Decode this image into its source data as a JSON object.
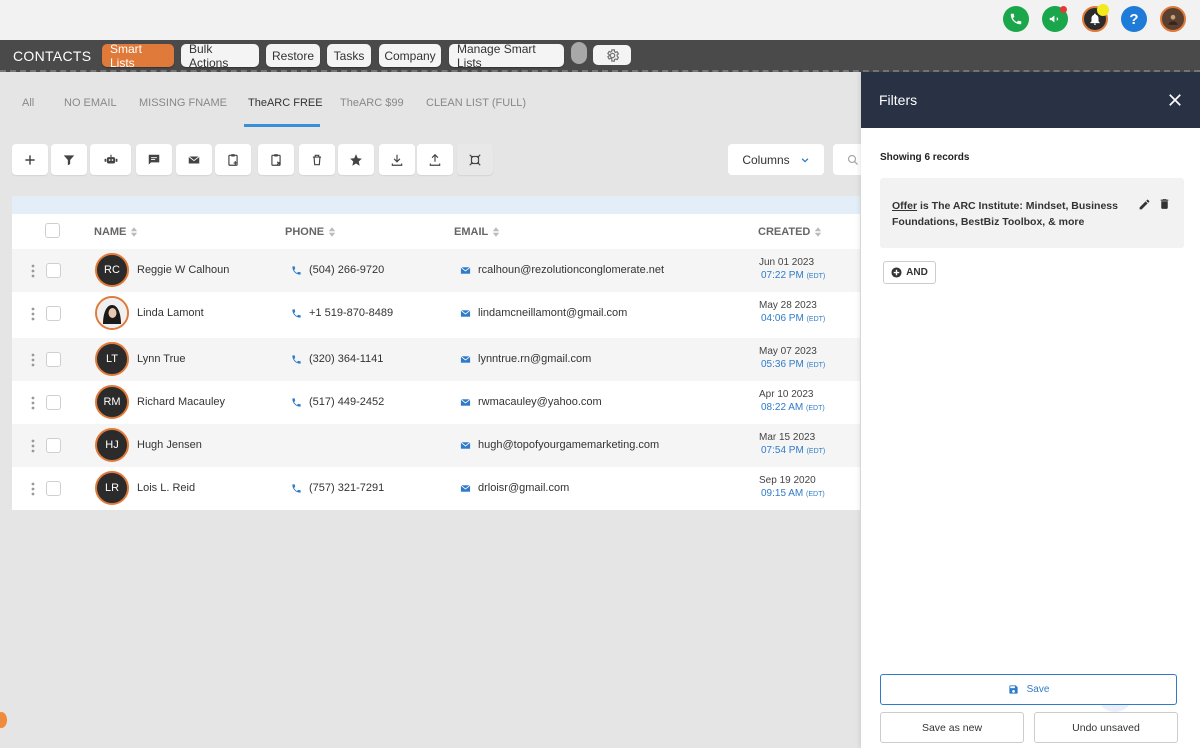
{
  "colors": {
    "accent": "#e07a3a",
    "link": "#2f7bc8",
    "panel_header": "#283244",
    "phone_green": "#1aa64a",
    "help_blue": "#1e7bd8"
  },
  "topbar": {
    "icons": [
      "phone-icon",
      "megaphone-icon",
      "bell-icon",
      "help-icon",
      "user-avatar"
    ],
    "help_label": "?"
  },
  "nav": {
    "title": "CONTACTS",
    "buttons": [
      "Smart Lists",
      "Bulk Actions",
      "Restore",
      "Tasks",
      "Company",
      "Manage Smart Lists"
    ]
  },
  "tabs": [
    "All",
    "NO EMAIL",
    "MISSING FNAME",
    "TheARC FREE",
    "TheARC $99",
    "CLEAN LIST (FULL)"
  ],
  "toolbar": {
    "icons": [
      "add-icon",
      "filter-icon",
      "robot-icon",
      "message-icon",
      "email-icon",
      "clipboard-add-icon",
      "clipboard-remove-icon",
      "trash-icon",
      "star-icon",
      "download-icon",
      "upload-icon",
      "merge-icon"
    ],
    "columns_label": "Columns"
  },
  "table": {
    "headers": {
      "name": "NAME",
      "phone": "PHONE",
      "email": "EMAIL",
      "created": "CREATED"
    },
    "rows": [
      {
        "initials": "RC",
        "name": "Reggie W Calhoun",
        "phone": "(504) 266-9720",
        "email": "rcalhoun@rezolutionconglomerate.net",
        "date": "Jun 01 2023",
        "time": "07:22 PM",
        "tz": "(EDT)"
      },
      {
        "initials": "",
        "name": "Linda Lamont",
        "phone": "+1 519-870-8489",
        "email": "lindamcneillamont@gmail.com",
        "date": "May 28 2023",
        "time": "04:06 PM",
        "tz": "(EDT)"
      },
      {
        "initials": "LT",
        "name": "Lynn True",
        "phone": "(320) 364-1141",
        "email": "lynntrue.rn@gmail.com",
        "date": "May 07 2023",
        "time": "05:36 PM",
        "tz": "(EDT)"
      },
      {
        "initials": "RM",
        "name": "Richard Macauley",
        "phone": "(517) 449-2452",
        "email": "rwmacauley@yahoo.com",
        "date": "Apr 10 2023",
        "time": "08:22 AM",
        "tz": "(EDT)"
      },
      {
        "initials": "HJ",
        "name": "Hugh Jensen",
        "phone": "",
        "email": "hugh@topofyourgamemarketing.com",
        "date": "Mar 15 2023",
        "time": "07:54 PM",
        "tz": "(EDT)"
      },
      {
        "initials": "LR",
        "name": "Lois L. Reid",
        "phone": "(757) 321-7291",
        "email": "drloisr@gmail.com",
        "date": "Sep 19 2020",
        "time": "09:15 AM",
        "tz": "(EDT)"
      }
    ]
  },
  "filters": {
    "title": "Filters",
    "records": "Showing 6 records",
    "filter_field": "Offer",
    "filter_rest": " is The ARC Institute: Mindset, Business Foundations, BestBiz Toolbox, & more",
    "and_label": "AND",
    "save_label": "Save",
    "save_new_label": "Save as new",
    "undo_label": "Undo unsaved"
  }
}
